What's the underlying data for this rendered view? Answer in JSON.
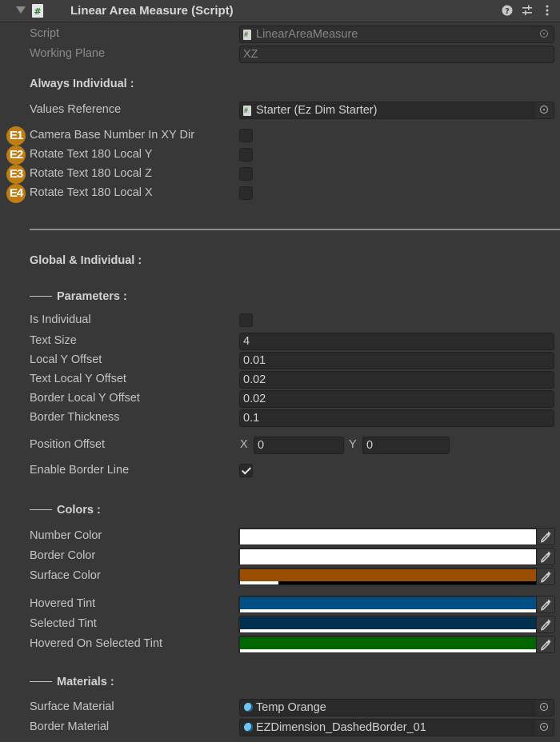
{
  "header": {
    "title": "Linear Area Measure (Script)",
    "icons": [
      "foldout-arrow-icon",
      "script-icon",
      "help-icon",
      "preset-sliders-icon",
      "kebab-menu-icon"
    ]
  },
  "top_fields": {
    "script_label": "Script",
    "script_value": "LinearAreaMeasure",
    "working_plane_label": "Working Plane",
    "working_plane_value": "XZ"
  },
  "always_individual": {
    "heading": "Always Individual :",
    "values_reference_label": "Values Reference",
    "values_reference_value": "Starter (Ez Dim Starter)",
    "toggles": [
      {
        "badge": "E1",
        "label": "Camera Base Number In XY Dir",
        "checked": false
      },
      {
        "badge": "E2",
        "label": "Rotate Text 180 Local Y",
        "checked": false
      },
      {
        "badge": "E3",
        "label": "Rotate Text 180 Local Z",
        "checked": false
      },
      {
        "badge": "E4",
        "label": "Rotate Text 180 Local X",
        "checked": false
      }
    ]
  },
  "global_individual": {
    "heading": "Global & Individual :",
    "parameters_heading": "Parameters :",
    "is_individual_label": "Is Individual",
    "is_individual_checked": false,
    "fields": [
      {
        "label": "Text Size",
        "value": "4"
      },
      {
        "label": "Local Y Offset",
        "value": "0.01"
      },
      {
        "label": "Text Local Y Offset",
        "value": "0.02"
      },
      {
        "label": "Border Local Y Offset",
        "value": "0.02"
      },
      {
        "label": "Border Thickness",
        "value": "0.1"
      }
    ],
    "position_offset": {
      "label": "Position Offset",
      "x_label": "X",
      "x": "0",
      "y_label": "Y",
      "y": "0"
    },
    "enable_border_line": {
      "label": "Enable Border Line",
      "checked": true
    }
  },
  "colors": {
    "heading": "Colors :",
    "items": [
      {
        "label": "Number Color",
        "color": "#ffffff",
        "alpha": 1.0
      },
      {
        "label": "Border Color",
        "color": "#ffffff",
        "alpha": 1.0
      },
      {
        "label": "Surface Color",
        "color": "#9a4f00",
        "alpha": 0.13
      },
      {
        "label": "Hovered Tint",
        "color": "#004f85",
        "alpha": 1.0
      },
      {
        "label": "Selected Tint",
        "color": "#002f4f",
        "alpha": 1.0
      },
      {
        "label": "Hovered On Selected Tint",
        "color": "#006600",
        "alpha": 1.0
      }
    ]
  },
  "materials": {
    "heading": "Materials :",
    "surface_label": "Surface Material",
    "surface_value": "Temp Orange",
    "border_label": "Border Material",
    "border_value": "EZDimension_DashedBorder_01"
  }
}
